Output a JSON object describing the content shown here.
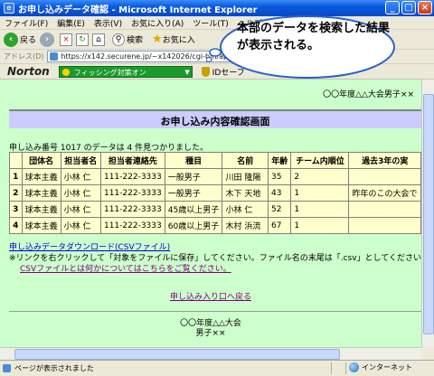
{
  "window": {
    "title": "お申し込みデータ確認 - Microsoft Internet Explorer",
    "minimize": "_",
    "maximize": "□",
    "close": "×"
  },
  "menu": [
    "ファイル(F)",
    "編集(E)",
    "表示(V)",
    "お気に入り(A)",
    "ツール(T)",
    "ヘルプ(H)"
  ],
  "toolbar": {
    "back_label": "戻る",
    "search_label": "検索",
    "favorites_label": "お気に入"
  },
  "address": {
    "label": "アドレス(D)",
    "url": "https://x142.securene.jp/~x142026/cgi-bin/app00/refer.cgi"
  },
  "norton": {
    "logo": "Norton",
    "phishing_label": "フィッシング対策オン",
    "idsafe_label": "IDセーフ"
  },
  "callout": {
    "text": "本部のデータを検索した結果が表示される。"
  },
  "page": {
    "event_name_top": "〇〇年度△△大会男子××",
    "title": "お申し込み内容確認画面",
    "result_message": "申し込み番号 1017 のデータは 4 件見つかりました。",
    "table": {
      "headers": [
        "",
        "団体名",
        "担当者名",
        "担当者連絡先",
        "種目",
        "名前",
        "年齢",
        "チーム内順位",
        "過去3年の実"
      ],
      "rows": [
        [
          "1",
          "球本主義",
          "小林 仁",
          "111-222-3333",
          "一般男子",
          "川田 隆陽",
          "35",
          "2",
          ""
        ],
        [
          "2",
          "球本主義",
          "小林 仁",
          "111-222-3333",
          "一般男子",
          "木下 天地",
          "43",
          "1",
          "昨年のこの大会で"
        ],
        [
          "3",
          "球本主義",
          "小林 仁",
          "111-222-3333",
          "45歳以上男子",
          "小林 仁",
          "52",
          "1",
          ""
        ],
        [
          "4",
          "球本主義",
          "小林 仁",
          "111-222-3333",
          "60歳以上男子",
          "木村 浜流",
          "67",
          "1",
          ""
        ]
      ]
    },
    "csv_download_link": "申し込みデータダウンロード(CSVファイル)",
    "csv_note": "※リンクを右クリックして「対象をファイルに保存」してください。ファイル名の末尾は「.csv」としてください。",
    "csv_help_link": "CSVファイルとは何かについてはこちらをご覧ください。",
    "return_link": "申し込み入り口へ戻る",
    "footer_line1": "〇〇年度△△大会",
    "footer_line2": "男子××"
  },
  "status": {
    "text": "ページが表示されました",
    "zone": "インターネット"
  }
}
